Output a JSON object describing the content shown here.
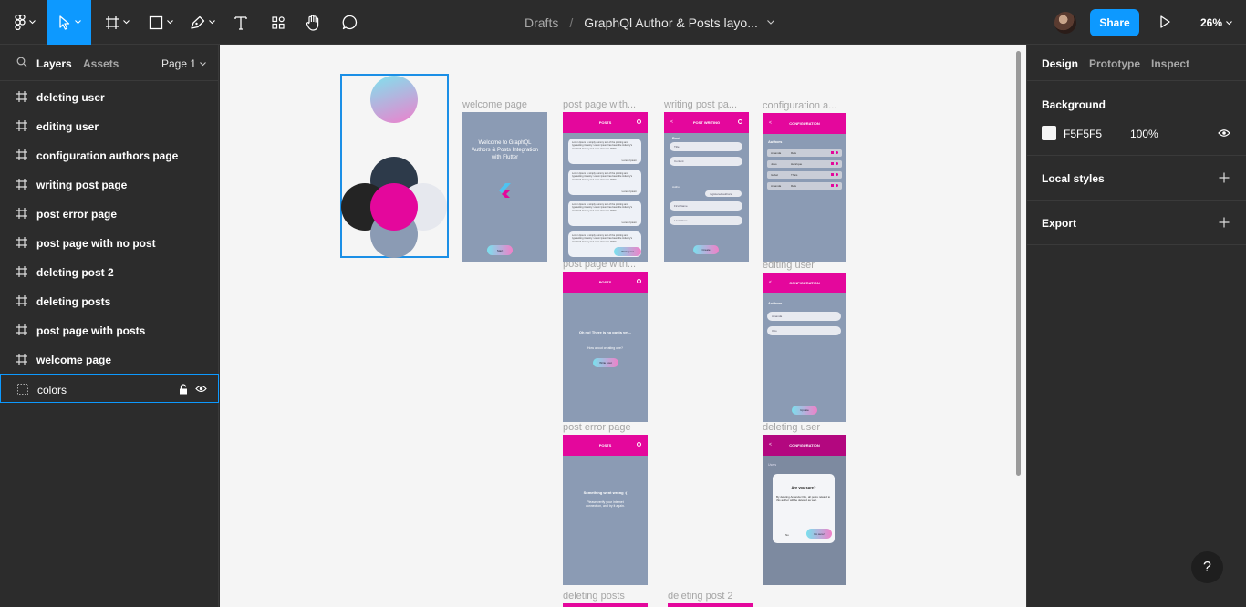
{
  "breadcrumb": {
    "drafts": "Drafts",
    "separator": "/",
    "file_name": "GraphQl Author & Posts layo..."
  },
  "toolbar": {
    "share_label": "Share",
    "zoom": "26%"
  },
  "left_panel": {
    "tabs": {
      "layers": "Layers",
      "assets": "Assets"
    },
    "page": "Page 1",
    "layers": [
      {
        "name": "deleting user",
        "icon": "frame-icon"
      },
      {
        "name": "editing user",
        "icon": "frame-icon"
      },
      {
        "name": "configuration authors page",
        "icon": "frame-icon"
      },
      {
        "name": "writing post page",
        "icon": "frame-icon"
      },
      {
        "name": "post error page",
        "icon": "frame-icon"
      },
      {
        "name": "post page with no post",
        "icon": "frame-icon"
      },
      {
        "name": "deleting post 2",
        "icon": "frame-icon"
      },
      {
        "name": "deleting posts",
        "icon": "frame-icon"
      },
      {
        "name": "post page with posts",
        "icon": "frame-icon"
      },
      {
        "name": "welcome page",
        "icon": "frame-icon"
      },
      {
        "name": "colors",
        "icon": "group-icon",
        "selected": true
      }
    ]
  },
  "canvas": {
    "frame_labels": {
      "welcome": "welcome page",
      "post_with": "post page with...",
      "writing": "writing post pa...",
      "config": "configuration a...",
      "post_no": "post page with...",
      "editing": "editing user",
      "error": "post error page",
      "deleting_user": "deleting user",
      "deleting_posts": "deleting posts",
      "deleting_post2": "deleting post 2"
    },
    "colors_swatches": [
      "#8eddea",
      "#2d3a4a",
      "#242424",
      "#e4079c",
      "#e6e8ee",
      "#8b9bb4"
    ],
    "welcome": {
      "line1": "Welcome to GraphQL",
      "line2": "Authors & Posts Integration",
      "line3": "with Flutter",
      "button": "Start"
    },
    "posts_title": "POSTS",
    "post_card_text": "Lorem Ipsum is simply dummy text of the printing and typesetting industry. Lorem Ipsum has been the industry's standard dummy text ever since the 1500s.",
    "post_card_author": "Lorem Ipsum",
    "write_button": "Write post",
    "writing": {
      "title": "POST WRITING",
      "section": "Post",
      "fields": [
        "Title",
        "Content"
      ],
      "author_label": "Author",
      "author_select": "registered authors",
      "first_name": "First Name",
      "last_name": "Last Name",
      "button": "Create"
    },
    "config": {
      "title": "CONFIGURATION",
      "section": "Authors",
      "rows": [
        [
          "Amanda",
          "Reis"
        ],
        [
          "Joao",
          "Henrique"
        ],
        [
          "Isabel",
          "Thais"
        ],
        [
          "Amanda",
          "Reis"
        ]
      ]
    },
    "no_post": {
      "title": "Oh no! There is no posts yet...",
      "subtitle": "How about creating one?",
      "button": "Write post"
    },
    "editing": {
      "title": "CONFIGURATION",
      "section": "Authors",
      "fields": [
        "Amanda",
        "Otto"
      ],
      "button": "Update"
    },
    "error": {
      "title": "Something went wrong :(",
      "subtitle": "Please verify your internet connection, and try it again."
    },
    "deleting": {
      "title": "CONFIGURATION",
      "section": "Users",
      "dialog_title": "Are you sure?",
      "dialog_text": "By deleting Amanda Otto, all posts related to this author will be deleted as well.",
      "no": "No",
      "yes": "I'm sure!"
    }
  },
  "right_panel": {
    "tabs": {
      "design": "Design",
      "prototype": "Prototype",
      "inspect": "Inspect"
    },
    "background": {
      "title": "Background",
      "hex": "F5F5F5",
      "opacity": "100%",
      "swatch": "#f5f5f5"
    },
    "local_styles": "Local styles",
    "export": "Export"
  },
  "help": "?"
}
